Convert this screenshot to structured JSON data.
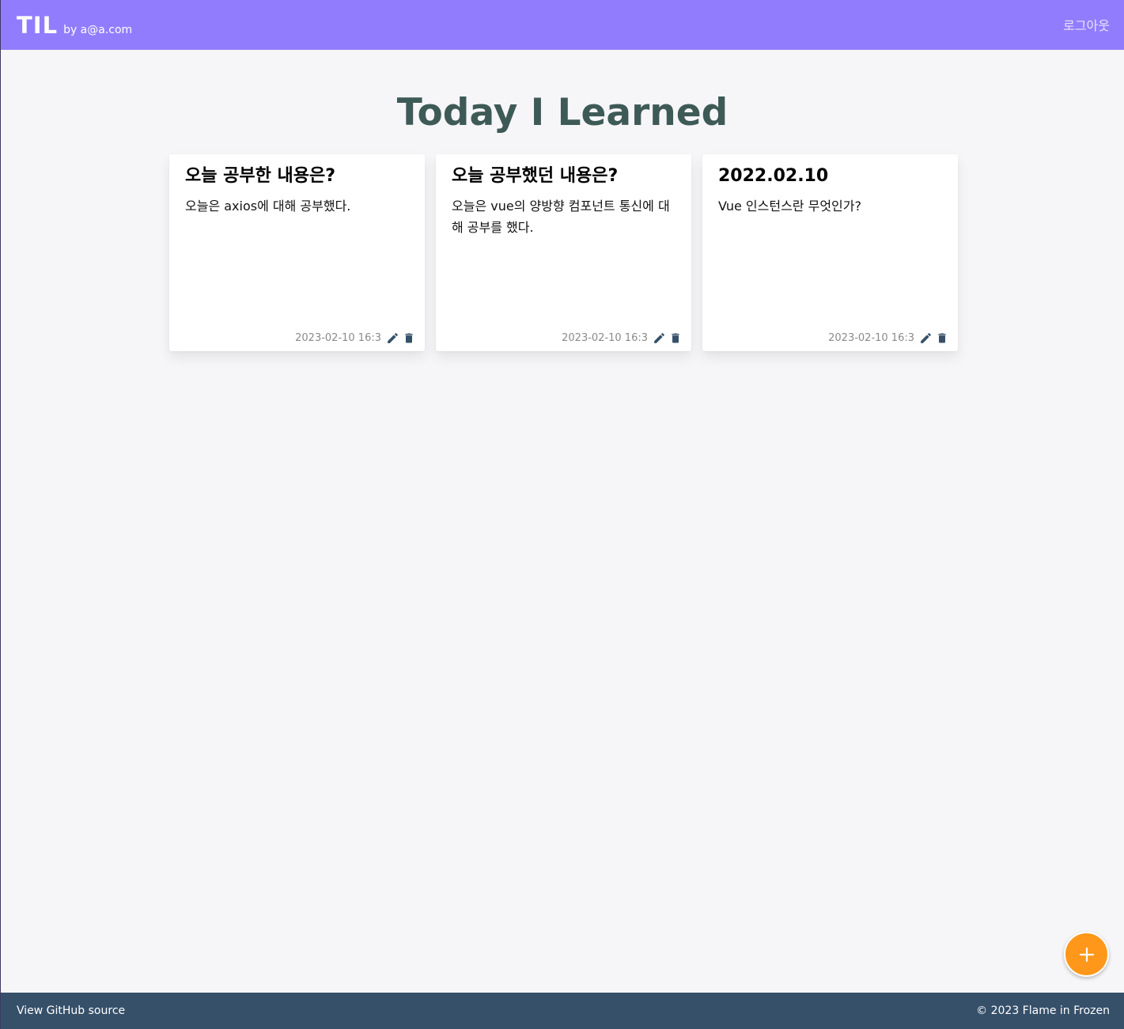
{
  "header": {
    "title": "TIL",
    "user_label": "by a@a.com",
    "logout_label": "로그아웃"
  },
  "main": {
    "page_title": "Today I Learned",
    "posts": [
      {
        "title": "오늘 공부한 내용은?",
        "contents": "오늘은 axios에 대해 공부했다.",
        "date": "2023-02-10 16:3",
        "edit_icon": "pencil-icon",
        "delete_icon": "trash-icon"
      },
      {
        "title": "오늘 공부했던 내용은?",
        "contents": "오늘은 vue의 양방향 컴포넌트 통신에 대해 공부를 했다.",
        "date": "2023-02-10 16:3",
        "edit_icon": "pencil-icon",
        "delete_icon": "trash-icon"
      },
      {
        "title": "2022.02.10",
        "contents": "Vue 인스턴스란 무엇인가?",
        "date": "2023-02-10 16:3",
        "edit_icon": "pencil-icon",
        "delete_icon": "trash-icon"
      }
    ],
    "add_button_icon": "plus-icon"
  },
  "footer": {
    "github_link": "View GitHub source",
    "copyright": "© 2023 Flame in Frozen"
  },
  "colors": {
    "header_bg": "#927cfe",
    "title_color": "#3e5a57",
    "fab_bg": "#ff981a",
    "footer_bg": "#36506a",
    "icon_color": "#36506a"
  }
}
